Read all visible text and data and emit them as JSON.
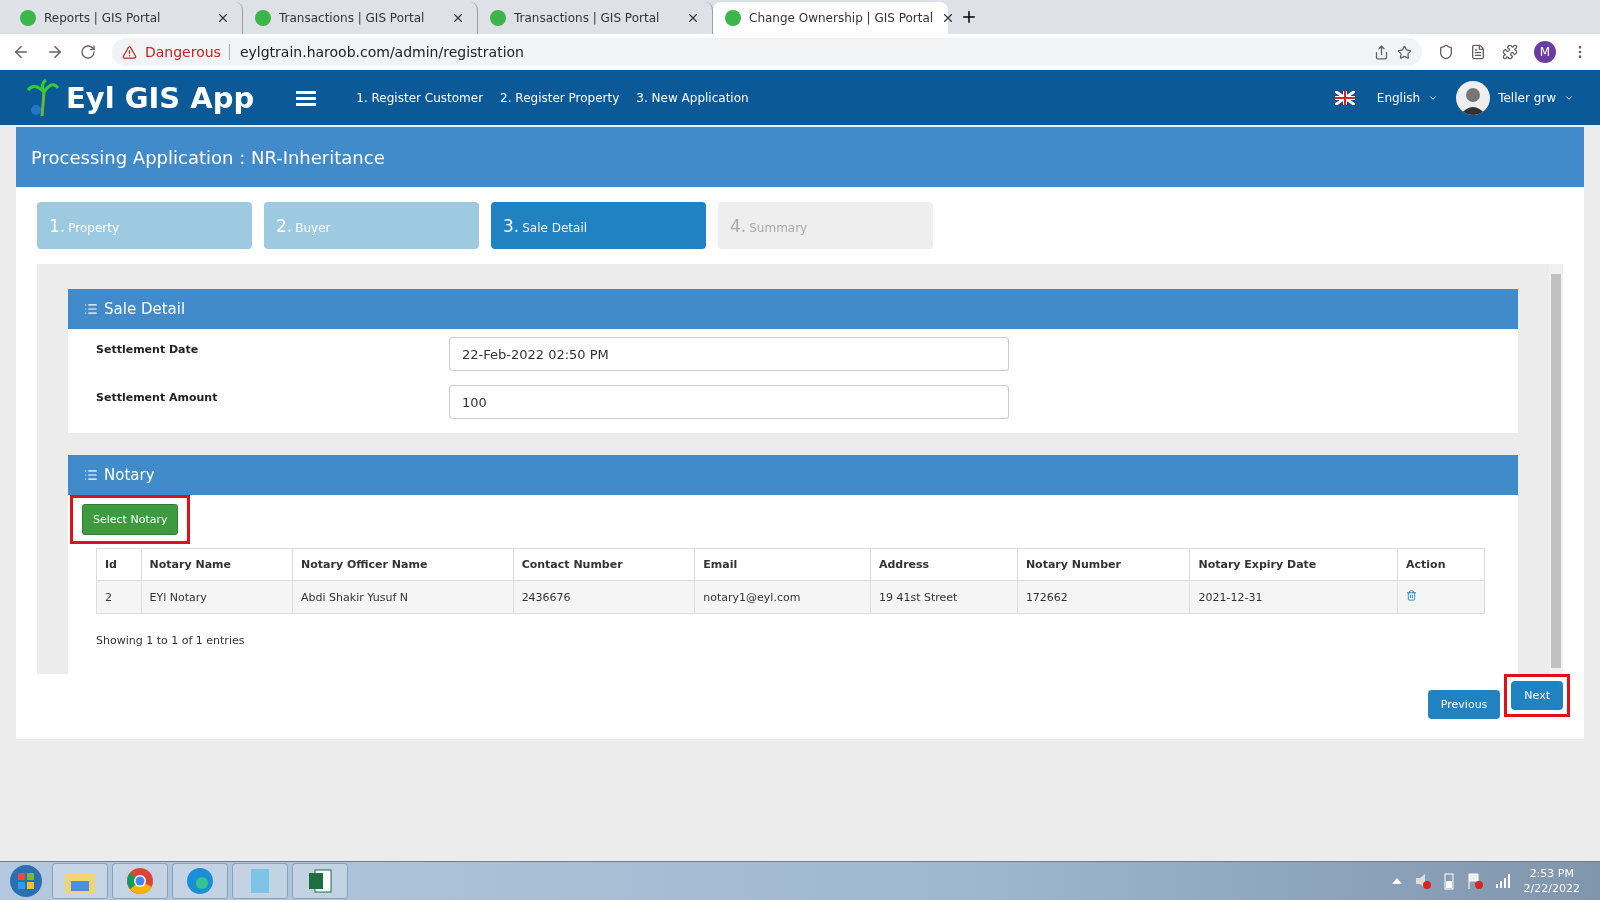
{
  "browser": {
    "tabs": [
      {
        "title": "Reports | GIS Portal",
        "selected": false
      },
      {
        "title": "Transactions | GIS Portal",
        "selected": false
      },
      {
        "title": "Transactions | GIS Portal",
        "selected": false
      },
      {
        "title": "Change Ownership | GIS Portal",
        "selected": true
      }
    ],
    "security": "Dangerous",
    "url": "eylgtrain.haroob.com/admin/registration",
    "profile": "M"
  },
  "header": {
    "app_name": "Eyl GIS App",
    "nav": [
      "1. Register Customer",
      "2. Register Property",
      "3. New Application"
    ],
    "language": "English",
    "user": "Teller grw"
  },
  "page_title": "Processing Application : NR-Inheritance",
  "steps": [
    {
      "number": "1.",
      "label": "Property",
      "done": true,
      "selected": false
    },
    {
      "number": "2.",
      "label": "Buyer",
      "done": true,
      "selected": false
    },
    {
      "number": "3.",
      "label": "Sale Detail",
      "done": false,
      "selected": true
    },
    {
      "number": "4.",
      "label": "Summary",
      "done": false,
      "selected": false
    }
  ],
  "sale_detail": {
    "title": "Sale Detail",
    "fields": [
      {
        "label": "Settlement Date",
        "value": "22-Feb-2022 02:50 PM"
      },
      {
        "label": "Settlement Amount",
        "value": "100"
      }
    ]
  },
  "notary": {
    "title": "Notary",
    "select_button": {
      "label": "Select Notary",
      "highlighted": true
    },
    "columns": [
      "Id",
      "Notary Name",
      "Notary Officer Name",
      "Contact Number",
      "Email",
      "Address",
      "Notary Number",
      "Notary Expiry Date",
      "Action"
    ],
    "rows": [
      {
        "cells": [
          "2",
          "EYl Notary",
          "Abdi Shakir Yusuf N",
          "2436676",
          "notary1@eyl.com",
          "19 41st Street",
          "172662",
          "2021-12-31"
        ]
      }
    ],
    "info": "Showing 1 to 1 of 1 entries"
  },
  "buttons": [
    {
      "label": "Previous",
      "highlighted": false
    },
    {
      "label": "Next",
      "highlighted": true
    }
  ],
  "taskbar": {
    "time": "2:53 PM",
    "date": "2/22/2022"
  }
}
